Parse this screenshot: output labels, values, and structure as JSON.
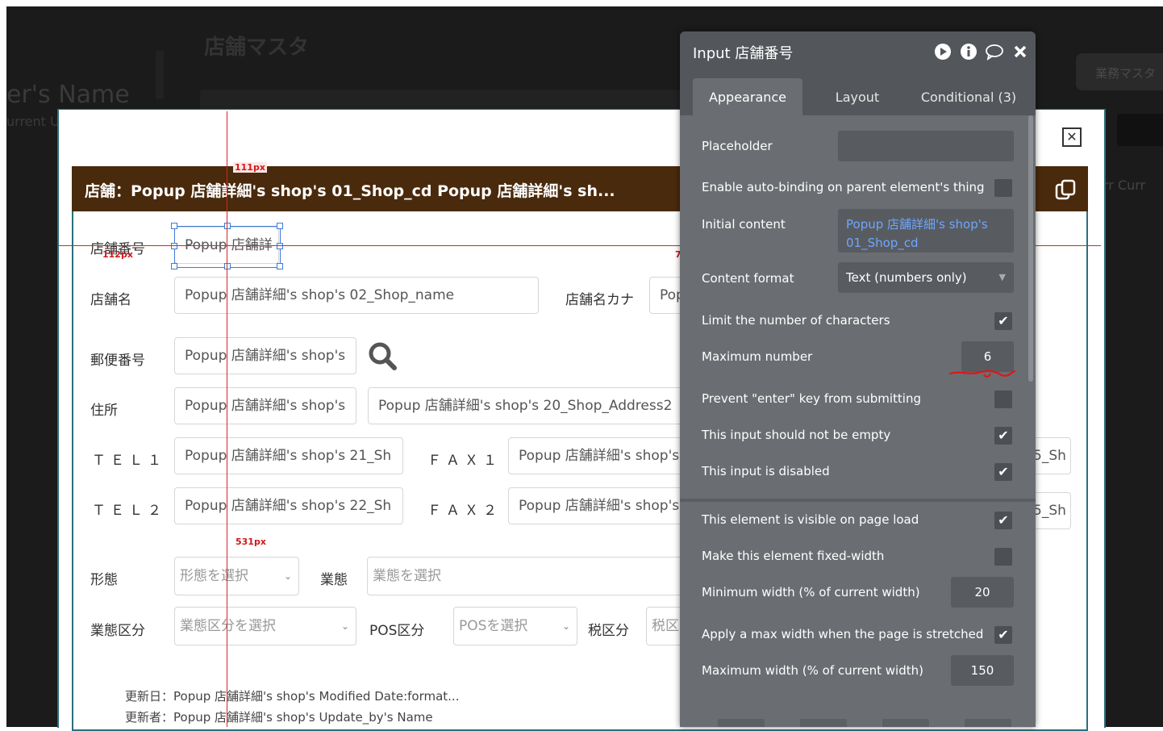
{
  "background": {
    "title": "店舗マスタ",
    "owner_name": "er's Name",
    "current": "urrent U",
    "right_card": "業務マスタ",
    "right_current": "rr Curr"
  },
  "popup": {
    "header": "店舗：Popup 店舗詳細's shop's 01_Shop_cd Popup 店舗詳細's sh...",
    "close_icon": "close-x-icon",
    "fields": {
      "shop_no": {
        "label": "店舗番号",
        "value": "Popup 店舗詳"
      },
      "shop_name": {
        "label": "店舗名",
        "value": "Popup 店舗詳細's shop's 02_Shop_name"
      },
      "shop_kana": {
        "label": "店舗名カナ",
        "value": "Pop"
      },
      "postal": {
        "label": "郵便番号",
        "value": "Popup 店舗詳細's shop's"
      },
      "address": {
        "label": "住所",
        "value": "Popup 店舗詳細's shop's",
        "value2": "Popup 店舗詳細's shop's 20_Shop_Address2"
      },
      "tel1": {
        "label": "ＴＥＬ１",
        "value": "Popup 店舗詳細's shop's 21_Sh"
      },
      "fax1": {
        "label": "ＦＡＸ１",
        "value": "Popup 店舗詳細's shop's"
      },
      "tel2": {
        "label": "ＴＥＬ２",
        "value": "Popup 店舗詳細's shop's 22_Sh"
      },
      "fax2": {
        "label": "ＦＡＸ２",
        "value": "Popup 店舗詳細's shop's"
      },
      "right1": "5_Sh",
      "right2": "5_Sh",
      "form": {
        "label": "形態",
        "placeholder": "形態を選択"
      },
      "business": {
        "label": "業態",
        "placeholder": "業態を選択"
      },
      "business_cat": {
        "label": "業態区分",
        "placeholder": "業態区分を選択"
      },
      "pos": {
        "label": "POS区分",
        "placeholder": "POSを選択"
      },
      "tax": {
        "label": "税区分",
        "placeholder": "税区"
      }
    },
    "footer": {
      "updated_on": "更新日：Popup 店舗詳細's shop's Modified Date:format...",
      "updated_by": "更新者：Popup 店舗詳細's shop's Update_by's Name"
    }
  },
  "guides": {
    "top_measure": "111px",
    "left_measure": "112px",
    "bottom_measure": "531px",
    "right_mark": "7"
  },
  "property_editor": {
    "title": "Input 店舗番号",
    "tabs": [
      "Appearance",
      "Layout",
      "Conditional (3)"
    ],
    "active_tab": "Appearance",
    "rows": {
      "placeholder": {
        "label": "Placeholder",
        "value": ""
      },
      "auto_binding": {
        "label": "Enable auto-binding on parent element's thing",
        "checked": false
      },
      "initial_content": {
        "label": "Initial content",
        "value": "Popup 店舗詳細's shop's 01_Shop_cd"
      },
      "content_format": {
        "label": "Content format",
        "value": "Text (numbers only)"
      },
      "limit_chars": {
        "label": "Limit the number of characters",
        "checked": true
      },
      "max_number": {
        "label": "Maximum number",
        "value": "6"
      },
      "prevent_enter": {
        "label": "Prevent \"enter\" key from submitting",
        "checked": false
      },
      "not_empty": {
        "label": "This input should not be empty",
        "checked": true
      },
      "disabled": {
        "label": "This input is disabled",
        "checked": true
      },
      "visible": {
        "label": "This element is visible on page load",
        "checked": true
      },
      "fixed_width": {
        "label": "Make this element fixed-width",
        "checked": false
      },
      "min_width": {
        "label": "Minimum width (% of current width)",
        "value": "20"
      },
      "max_width_apply": {
        "label": "Apply a max width when the page is stretched",
        "checked": true
      },
      "max_width": {
        "label": "Maximum width (% of current width)",
        "value": "150"
      }
    },
    "icons": [
      "play-icon",
      "info-icon",
      "comment-icon",
      "close-icon"
    ],
    "check_glyph": "✔",
    "accent_color": "#6ea6ff"
  }
}
